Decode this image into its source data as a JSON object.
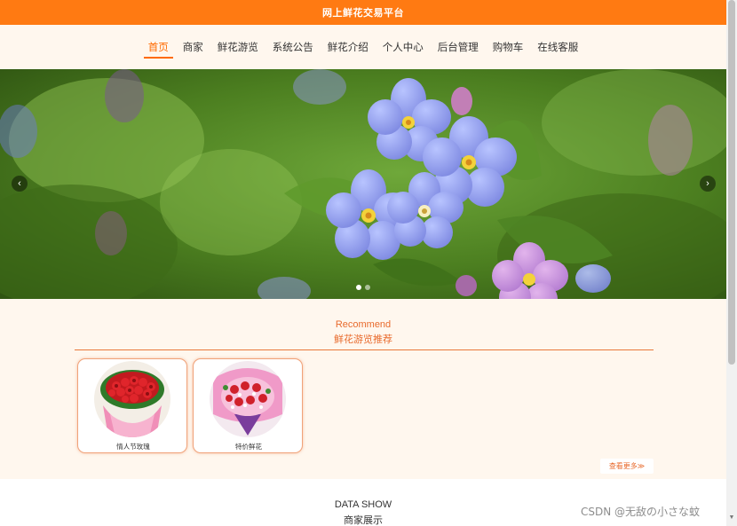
{
  "header": {
    "title": "网上鲜花交易平台"
  },
  "nav": {
    "items": [
      {
        "label": "首页",
        "active": true
      },
      {
        "label": "商家"
      },
      {
        "label": "鲜花游览"
      },
      {
        "label": "系统公告"
      },
      {
        "label": "鲜花介绍"
      },
      {
        "label": "个人中心"
      },
      {
        "label": "后台管理"
      },
      {
        "label": "购物车"
      },
      {
        "label": "在线客服"
      }
    ]
  },
  "carousel": {
    "prev_icon": "‹",
    "next_icon": "›",
    "slide_count": 2,
    "active_slide": 1
  },
  "recommend": {
    "title_en": "Recommend",
    "title_cn": "鲜花游览推荐",
    "items": [
      {
        "caption": "情人节玫瑰"
      },
      {
        "caption": "特价鲜花"
      }
    ],
    "more_label": "查看更多≫"
  },
  "data_show": {
    "title_en": "DATA SHOW",
    "title_cn": "商家展示"
  },
  "watermark": "CSDN @无敌の小さな蚊",
  "colors": {
    "accent": "#ff7a12",
    "accent_text": "#e86a2c",
    "section_bg": "#fff7ee"
  }
}
